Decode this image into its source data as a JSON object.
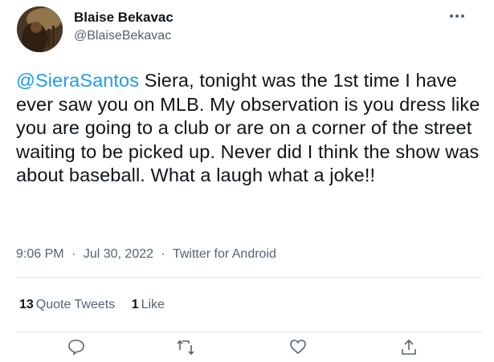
{
  "author": {
    "display_name": "Blaise Bekavac",
    "handle": "@BlaiseBekavac",
    "avatar_icon": "profile-photo"
  },
  "tweet": {
    "mention": "@SieraSantos",
    "text": " Siera, tonight was the 1st time I have ever saw you on MLB. My observation is you dress like you are going to a club or are on a corner of the street waiting to be picked up. Never did I think the show was about baseball. What a laugh what a joke!!"
  },
  "meta": {
    "time": "9:06 PM",
    "separator": "·",
    "date": "Jul 30, 2022",
    "source": "Twitter for Android"
  },
  "stats": {
    "quote_tweets_count": "13",
    "quote_tweets_label": "Quote Tweets",
    "likes_count": "1",
    "likes_label": "Like"
  },
  "icons": {
    "more": "more-horizontal-icon",
    "reply": "reply-icon",
    "retweet": "retweet-icon",
    "like": "heart-icon",
    "share": "share-icon"
  },
  "colors": {
    "link": "#1d9bf0",
    "secondary_text": "#536471",
    "primary_text": "#0f1419",
    "divider": "#e1e6ea"
  }
}
